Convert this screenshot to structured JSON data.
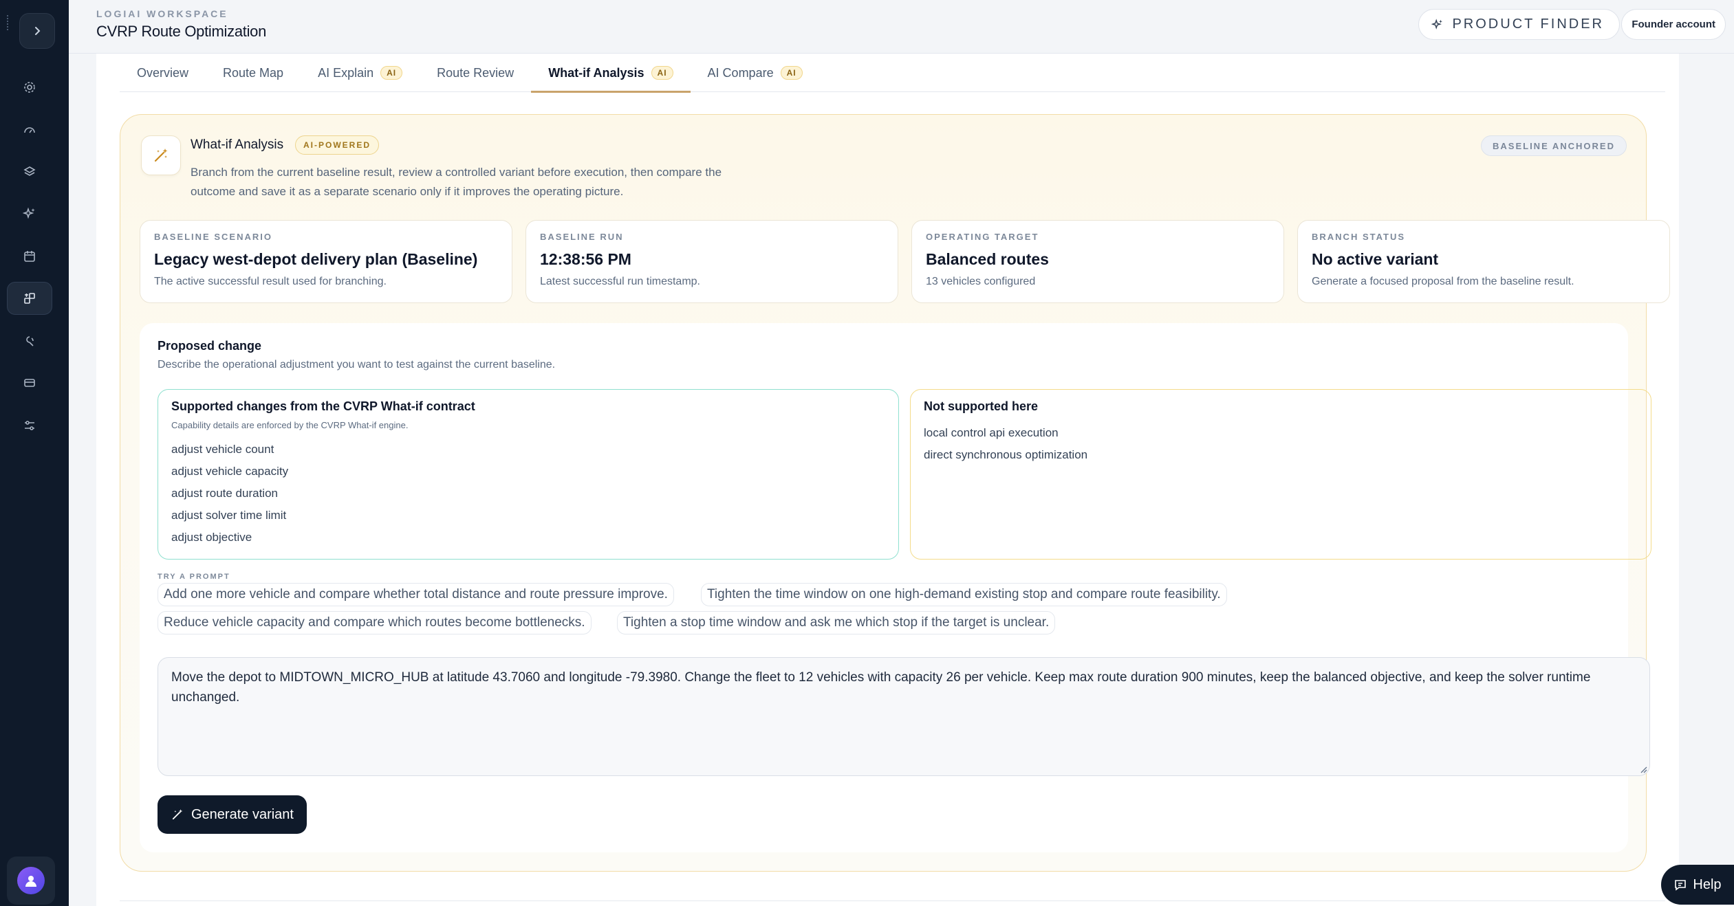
{
  "header": {
    "workspace": "LOGIAI WORKSPACE",
    "title": "CVRP Route Optimization",
    "product_finder": "PRODUCT FINDER",
    "account": "Founder account"
  },
  "tabs": [
    {
      "label": "Overview",
      "ai": ""
    },
    {
      "label": "Route Map",
      "ai": ""
    },
    {
      "label": "AI Explain",
      "ai": "AI"
    },
    {
      "label": "Route Review",
      "ai": ""
    },
    {
      "label": "What-if Analysis",
      "ai": "AI"
    },
    {
      "label": "AI Compare",
      "ai": "AI"
    }
  ],
  "card": {
    "title": "What-if Analysis",
    "badge": "AI-POWERED",
    "description": "Branch from the current baseline result, review a controlled variant before execution, then compare the outcome and save it as a separate scenario only if it improves the operating picture.",
    "anchored": "BASELINE ANCHORED"
  },
  "stats": [
    {
      "label": "BASELINE SCENARIO",
      "value": "Legacy west-depot delivery plan (Baseline)",
      "sub": "The active successful result used for branching."
    },
    {
      "label": "BASELINE RUN",
      "value": "12:38:56 PM",
      "sub": "Latest successful run timestamp."
    },
    {
      "label": "OPERATING TARGET",
      "value": "Balanced routes",
      "sub": "13 vehicles configured"
    },
    {
      "label": "BRANCH STATUS",
      "value": "No active variant",
      "sub": "Generate a focused proposal from the baseline result."
    }
  ],
  "form": {
    "title": "Proposed change",
    "description": "Describe the operational adjustment you want to test against the current baseline.",
    "supported": {
      "title": "Supported changes from the CVRP What-if contract",
      "subtitle": "Capability details are enforced by the CVRP What-if engine.",
      "items": [
        "adjust vehicle count",
        "adjust vehicle capacity",
        "adjust route duration",
        "adjust solver time limit",
        "adjust objective"
      ]
    },
    "not_supported": {
      "title": "Not supported here",
      "items": [
        "local control api execution",
        "direct synchronous optimization"
      ]
    },
    "try_label": "TRY A PROMPT",
    "prompts": [
      "Add one more vehicle and compare whether total distance and route pressure improve.",
      "Tighten the time window on one high-demand existing stop and compare route feasibility.",
      "Reduce vehicle capacity and compare which routes become bottlenecks.",
      "Tighten a stop time window and ask me which stop if the target is unclear."
    ],
    "textarea_value": "Move the depot to MIDTOWN_MICRO_HUB at latitude 43.7060 and longitude -79.3980. Change the fleet to 12 vehicles with capacity 26 per vehicle. Keep max route duration 900 minutes, keep the balanced objective, and keep the solver runtime unchanged.",
    "generate_label": "Generate variant"
  },
  "help_label": "Help"
}
